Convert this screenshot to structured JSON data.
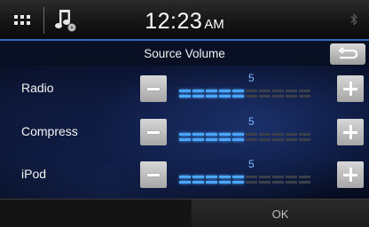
{
  "status_bar": {
    "time": "12:23",
    "ampm": "AM"
  },
  "screen": {
    "title": "Source Volume",
    "ok_label": "OK"
  },
  "meter": {
    "max_segments": 10,
    "active_color": "#4aa6ff",
    "inactive_color": "#3a3f4a"
  },
  "rows": [
    {
      "label": "Radio",
      "level": 5
    },
    {
      "label": "Compress",
      "level": 5
    },
    {
      "label": "iPod",
      "level": 5
    }
  ],
  "icons": {
    "menu": "grid-icon",
    "music": "music-note-icon",
    "bluetooth": "bluetooth-icon",
    "back": "return-arrow-icon",
    "decrease": "minus-icon",
    "increase": "plus-icon"
  }
}
